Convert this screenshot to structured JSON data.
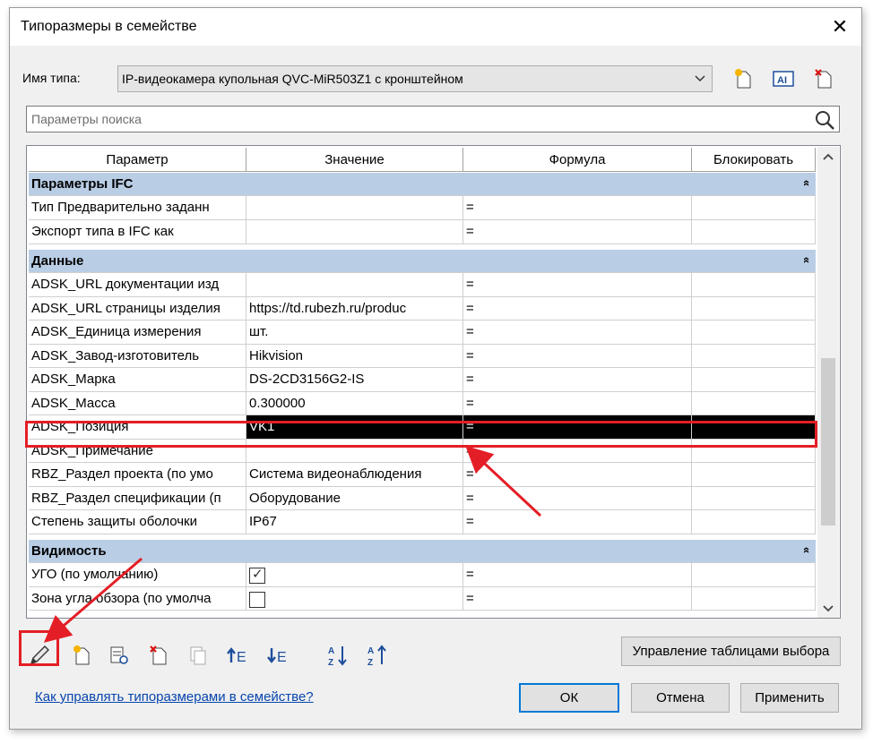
{
  "dialog": {
    "title": "Типоразмеры в семействе",
    "close_glyph": "✕"
  },
  "type_name": {
    "label": "Имя типа:",
    "value": "IP-видеокамера купольная QVC-MiR503Z1 с кронштейном"
  },
  "search": {
    "placeholder": "Параметры поиска"
  },
  "table": {
    "headers": [
      "Параметр",
      "Значение",
      "Формула",
      "Блокировать"
    ],
    "groups": [
      {
        "label": "Параметры IFC",
        "rows": [
          {
            "param": "Тип Предварительно заданн",
            "value": "",
            "formula": "="
          },
          {
            "param": "Экспорт типа в IFC как",
            "value": "",
            "formula": "="
          }
        ]
      },
      {
        "label": "Данные",
        "rows": [
          {
            "param": "ADSK_URL документации изд",
            "value": "",
            "formula": "="
          },
          {
            "param": "ADSK_URL страницы изделия",
            "value": "https://td.rubezh.ru/produc",
            "formula": "="
          },
          {
            "param": "ADSK_Единица измерения",
            "value": "шт.",
            "formula": "="
          },
          {
            "param": "ADSK_Завод-изготовитель",
            "value": "Hikvision",
            "formula": "="
          },
          {
            "param": "ADSK_Марка",
            "value": "DS-2CD3156G2-IS",
            "formula": "="
          },
          {
            "param": "ADSK_Масса",
            "value": "0.300000",
            "formula": "="
          },
          {
            "param": "ADSK_Позиция",
            "value": "VK1",
            "formula": "=",
            "selected": true
          },
          {
            "param": "ADSK_Примечание",
            "value": "",
            "formula": "="
          },
          {
            "param": "RBZ_Раздел проекта (по умо",
            "value": "Система видеонаблюдения",
            "formula": "="
          },
          {
            "param": "RBZ_Раздел спецификации (п",
            "value": "Оборудование",
            "formula": "="
          },
          {
            "param": "Степень защиты оболочки",
            "value": "IP67",
            "formula": "="
          }
        ]
      },
      {
        "label": "Видимость",
        "rows": [
          {
            "param": "УГО (по умолчанию)",
            "checked": true,
            "formula": "="
          },
          {
            "param": "Зона угла обзора (по умолча",
            "checked": false,
            "formula": "="
          }
        ]
      }
    ]
  },
  "buttons": {
    "manage_lookup": "Управление таблицами выбора",
    "ok": "ОК",
    "cancel": "Отмена",
    "apply": "Применить"
  },
  "help_link": "Как управлять типоразмерами в семействе?",
  "icons": {
    "collapse": "«",
    "sort_asc": "A↓Z",
    "sort_desc": "Z↓A"
  },
  "colors": {
    "group_header": "#b9cde5",
    "highlight": "#e41e26",
    "link": "#0645ad"
  }
}
